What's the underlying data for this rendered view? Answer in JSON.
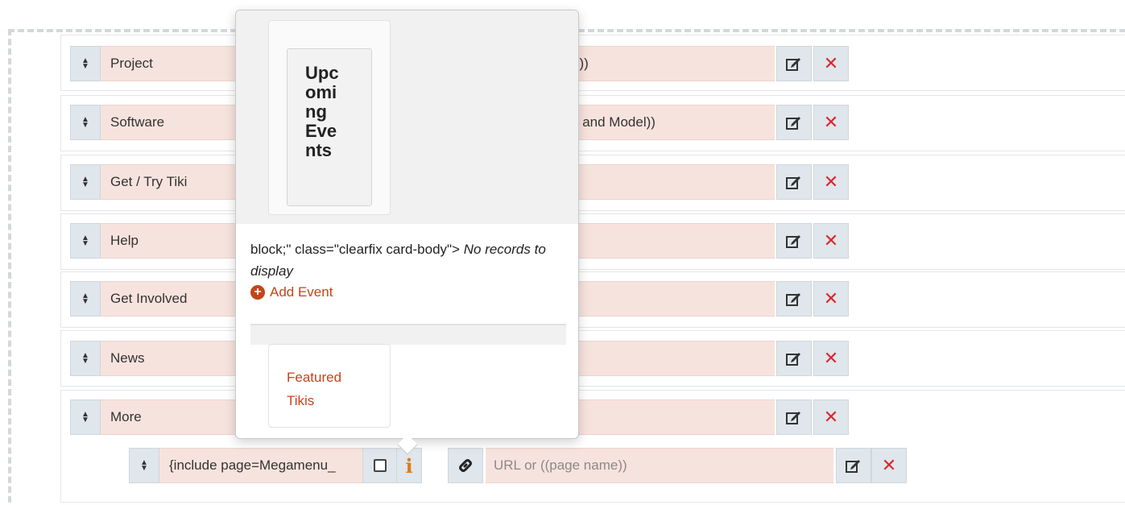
{
  "menu_items": [
    {
      "name": "Project",
      "url": "n))"
    },
    {
      "name": "Software",
      "url": "v and Model))"
    },
    {
      "name": "Get / Try Tiki",
      "url": ""
    },
    {
      "name": "Help",
      "url": ""
    },
    {
      "name": "Get Involved",
      "url": ""
    },
    {
      "name": "News",
      "url": ""
    },
    {
      "name": "More",
      "url": ""
    }
  ],
  "sub_item": {
    "name": "{include page=Megamenu_",
    "url_placeholder": "URL or ((page name))"
  },
  "popover": {
    "card_a_title": "Upcoming Events",
    "card_a_lines": [
      "Upc",
      "omi",
      "ng",
      "Eve",
      "nts"
    ],
    "raw_text": "block;\" class=\"clearfix card-body\">",
    "no_records": "No records to display",
    "add_event": "Add Event",
    "card_b_lines": [
      "Featured",
      "Tikis"
    ]
  },
  "icons": {
    "move": "sort-arrows-icon",
    "edit": "edit-icon",
    "delete": "close-icon",
    "link": "link-icon",
    "info": "info-icon",
    "checkbox": "checkbox-icon"
  },
  "colors": {
    "field_bg": "#f7e3dd",
    "button_bg": "#dfe6ec",
    "delete": "#d9272e",
    "link_orange": "#c4451a",
    "info_orange": "#e07b1a"
  }
}
